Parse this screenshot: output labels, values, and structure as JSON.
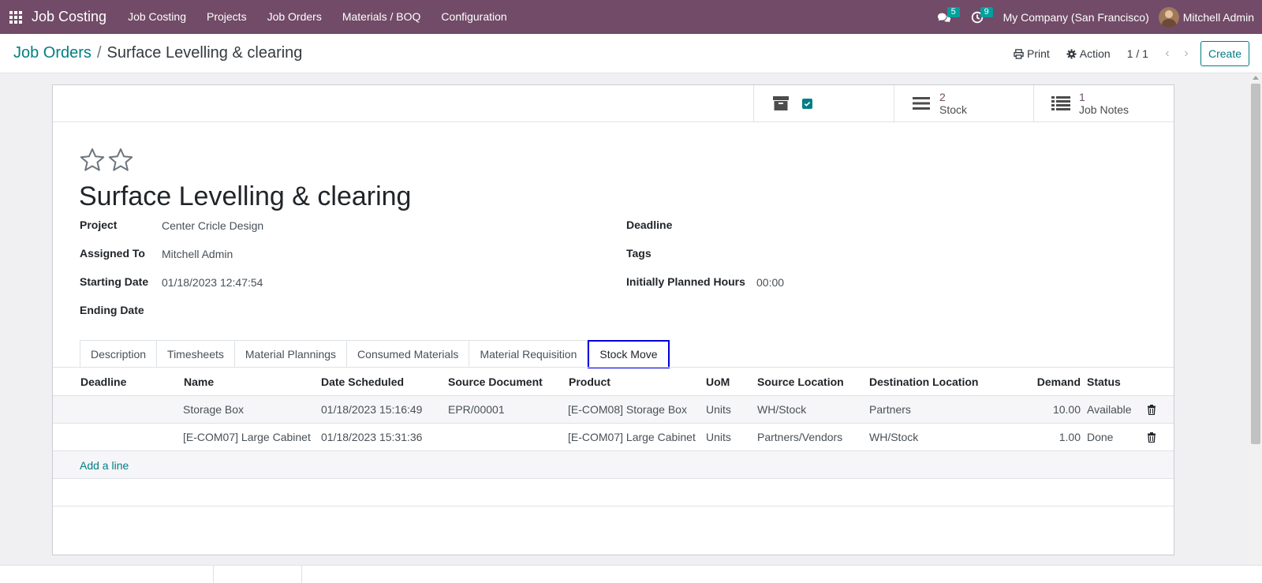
{
  "navbar": {
    "brand": "Job Costing",
    "menu": [
      "Job Costing",
      "Projects",
      "Job Orders",
      "Materials / BOQ",
      "Configuration"
    ],
    "messages_count": "5",
    "activities_count": "9",
    "company": "My Company (San Francisco)",
    "user": "Mitchell Admin"
  },
  "control_panel": {
    "breadcrumb_parent": "Job Orders",
    "breadcrumb_separator": "/",
    "breadcrumb_current": "Surface Levelling & clearing",
    "print_label": "Print",
    "action_label": "Action",
    "pager": "1 / 1",
    "create_label": "Create"
  },
  "stat_buttons": {
    "stock_value": "2",
    "stock_label": "Stock",
    "notes_value": "1",
    "notes_label": "Job Notes"
  },
  "record": {
    "title": "Surface Levelling & clearing",
    "fields_left": [
      {
        "label": "Project",
        "value": "Center Cricle Design"
      },
      {
        "label": "Assigned To",
        "value": "Mitchell Admin"
      },
      {
        "label": "Starting Date",
        "value": "01/18/2023 12:47:54"
      },
      {
        "label": "Ending Date",
        "value": ""
      }
    ],
    "fields_right": [
      {
        "label": "Deadline",
        "value": ""
      },
      {
        "label": "Tags",
        "value": ""
      },
      {
        "label": "Initially Planned Hours",
        "value": "00:00"
      }
    ]
  },
  "tabs": [
    "Description",
    "Timesheets",
    "Material Plannings",
    "Consumed Materials",
    "Material Requisition",
    "Stock Move"
  ],
  "active_tab": "Stock Move",
  "table": {
    "columns": [
      "Deadline",
      "Name",
      "Date Scheduled",
      "Source Document",
      "Product",
      "UoM",
      "Source Location",
      "Destination Location",
      "Demand",
      "Status"
    ],
    "rows": [
      [
        "",
        "Storage Box",
        "01/18/2023 15:16:49",
        "EPR/00001",
        "[E-COM08] Storage Box",
        "Units",
        "WH/Stock",
        "Partners",
        "10.00",
        "Available"
      ],
      [
        "",
        "[E-COM07] Large Cabinet",
        "01/18/2023 15:31:36",
        "",
        "[E-COM07] Large Cabinet",
        "Units",
        "Partners/Vendors",
        "WH/Stock",
        "1.00",
        "Done"
      ]
    ],
    "add_line": "Add a line"
  },
  "colors": {
    "navbar": "#714b67",
    "accent": "#017e84",
    "active_tab_border": "#0000dd"
  }
}
